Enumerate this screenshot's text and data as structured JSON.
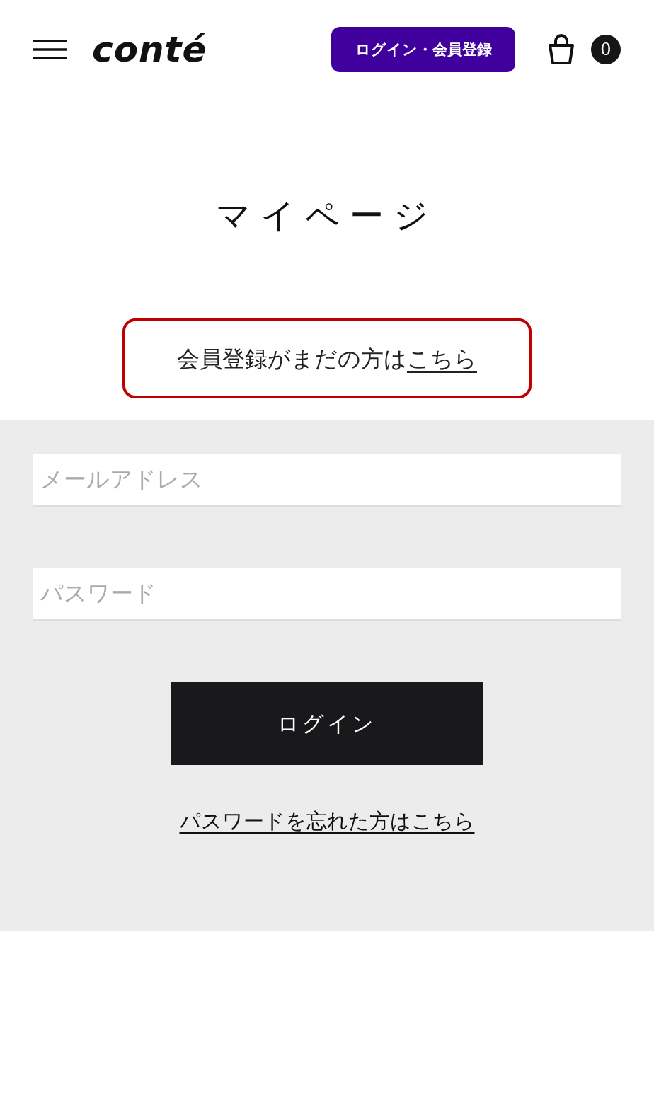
{
  "header": {
    "logo": "conté",
    "login_button": "ログイン・会員登録",
    "cart_count": "0"
  },
  "title": "マイページ",
  "register_prompt": {
    "text": "会員登録がまだの方は",
    "link": "こちら"
  },
  "form": {
    "email": {
      "placeholder": "メールアドレス"
    },
    "password": {
      "placeholder": "パスワード"
    },
    "submit": "ログイン",
    "forgot_link": "パスワードを忘れた方はこちら"
  }
}
